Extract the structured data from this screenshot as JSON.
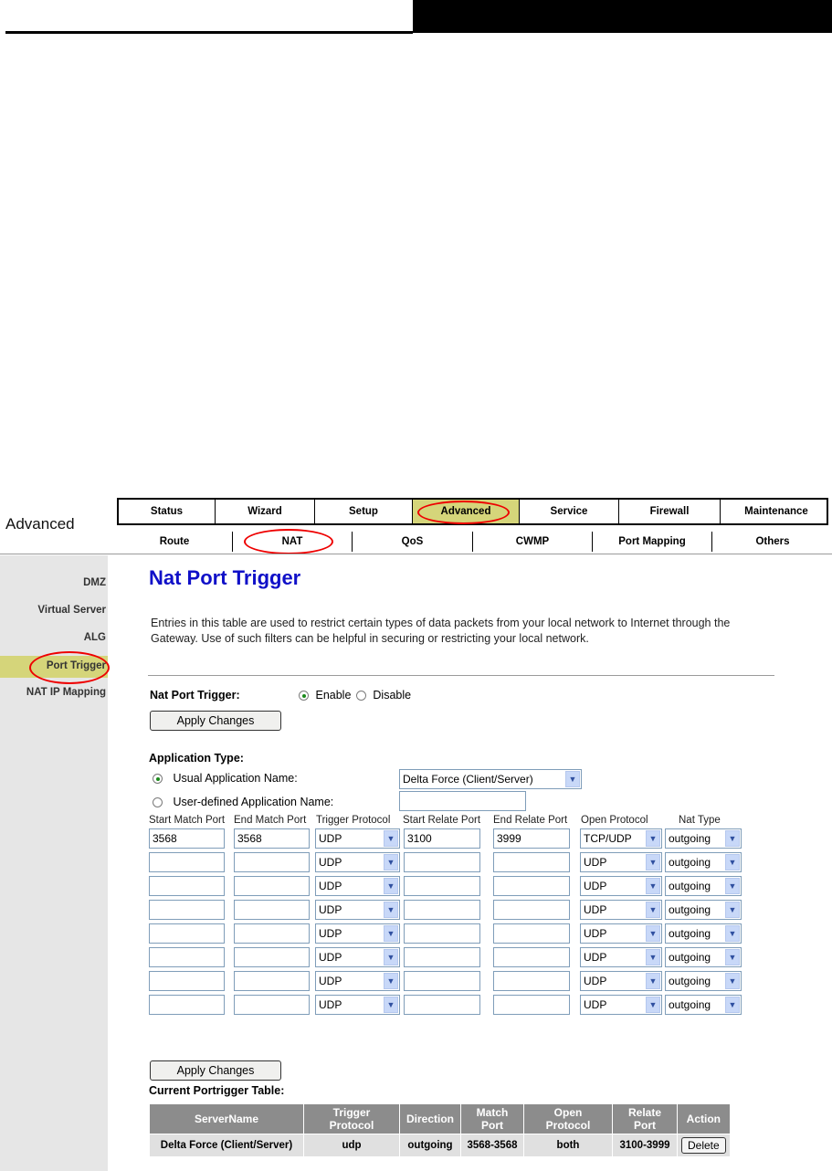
{
  "brand": "Advanced",
  "nav_top": [
    "Status",
    "Wizard",
    "Setup",
    "Advanced",
    "Service",
    "Firewall",
    "Maintenance"
  ],
  "nav_sub": [
    "Route",
    "NAT",
    "QoS",
    "CWMP",
    "Port Mapping",
    "Others"
  ],
  "sidebar": [
    "DMZ",
    "Virtual Server",
    "ALG",
    "Port Trigger",
    "NAT IP Mapping"
  ],
  "page_title": "Nat Port Trigger",
  "description": "Entries in this table are used to restrict certain types of data packets from your local network to Internet through the Gateway. Use of such filters can be helpful in securing or restricting your local network.",
  "trigger": {
    "label": "Nat Port Trigger:",
    "enable": "Enable",
    "disable": "Disable",
    "selected": "Enable"
  },
  "apply_label": "Apply Changes",
  "app_type": {
    "label": "Application Type:",
    "usual_label": "Usual Application Name:",
    "usual_value": "Delta Force (Client/Server)",
    "user_label": "User-defined Application Name:",
    "user_value": ""
  },
  "columns": [
    "Start Match Port",
    "End Match Port",
    "Trigger Protocol",
    "Start Relate Port",
    "End Relate Port",
    "Open Protocol",
    "Nat Type"
  ],
  "rows": [
    {
      "start_match": "3568",
      "end_match": "3568",
      "trigger": "UDP",
      "start_relate": "3100",
      "end_relate": "3999",
      "open": "TCP/UDP",
      "nat": "outgoing"
    },
    {
      "start_match": "",
      "end_match": "",
      "trigger": "UDP",
      "start_relate": "",
      "end_relate": "",
      "open": "UDP",
      "nat": "outgoing"
    },
    {
      "start_match": "",
      "end_match": "",
      "trigger": "UDP",
      "start_relate": "",
      "end_relate": "",
      "open": "UDP",
      "nat": "outgoing"
    },
    {
      "start_match": "",
      "end_match": "",
      "trigger": "UDP",
      "start_relate": "",
      "end_relate": "",
      "open": "UDP",
      "nat": "outgoing"
    },
    {
      "start_match": "",
      "end_match": "",
      "trigger": "UDP",
      "start_relate": "",
      "end_relate": "",
      "open": "UDP",
      "nat": "outgoing"
    },
    {
      "start_match": "",
      "end_match": "",
      "trigger": "UDP",
      "start_relate": "",
      "end_relate": "",
      "open": "UDP",
      "nat": "outgoing"
    },
    {
      "start_match": "",
      "end_match": "",
      "trigger": "UDP",
      "start_relate": "",
      "end_relate": "",
      "open": "UDP",
      "nat": "outgoing"
    },
    {
      "start_match": "",
      "end_match": "",
      "trigger": "UDP",
      "start_relate": "",
      "end_relate": "",
      "open": "UDP",
      "nat": "outgoing"
    }
  ],
  "current_table": {
    "title": "Current Portrigger Table:",
    "headers": [
      [
        "ServerName"
      ],
      [
        "Trigger",
        "Protocol"
      ],
      [
        "Direction"
      ],
      [
        "Match",
        "Port"
      ],
      [
        "Open",
        "Protocol"
      ],
      [
        "Relate",
        "Port"
      ],
      [
        "Action"
      ]
    ],
    "rows": [
      {
        "server": "Delta Force (Client/Server)",
        "trigger": "udp",
        "direction": "outgoing",
        "match": "3568-3568",
        "open": "both",
        "relate": "3100-3999",
        "action": "Delete"
      }
    ]
  },
  "colors": {
    "accent": "#d5d57a",
    "title": "#1010c8",
    "highlight_oval": "#e00000",
    "table_header": "#8c8c8c"
  }
}
